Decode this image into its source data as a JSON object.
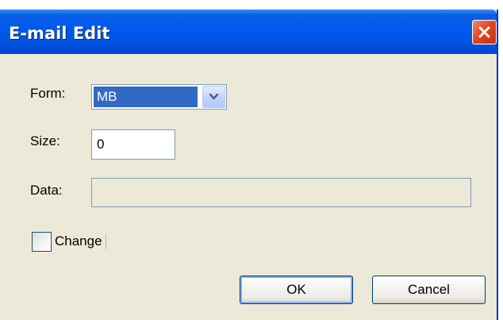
{
  "window": {
    "title": "E-mail Edit"
  },
  "form": {
    "form_label": "Form:",
    "form_value": "MB",
    "size_label": "Size:",
    "size_value": "0",
    "data_label": "Data:",
    "data_value": ""
  },
  "change": {
    "label": "Change",
    "checked": false
  },
  "buttons": {
    "ok_label": "OK",
    "cancel_label": "Cancel"
  },
  "icons": {
    "close": "close-icon",
    "dropdown": "chevron-down-icon"
  },
  "colors": {
    "titlebar": "#0054e3",
    "selection": "#316ac5",
    "close_button": "#e0421e",
    "dialog_background": "#ece9d8"
  }
}
